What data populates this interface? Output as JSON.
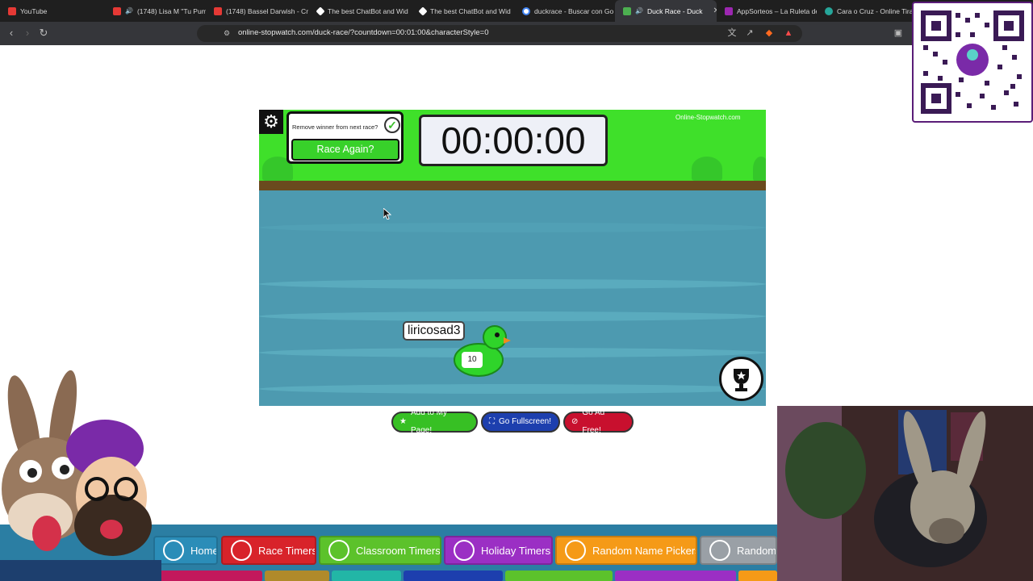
{
  "browser": {
    "tabs": [
      {
        "title": "YouTube",
        "favicon_color": "#e53935"
      },
      {
        "title": "(1748) Lisa M \"Tu Pum",
        "favicon_color": "#e53935"
      },
      {
        "title": "(1748) Bassel Darwish - Cr",
        "favicon_color": "#e53935"
      },
      {
        "title": "The best ChatBot and Wid",
        "favicon_color": "#ffffff"
      },
      {
        "title": "The best ChatBot and Wid",
        "favicon_color": "#ffffff"
      },
      {
        "title": "duckrace - Buscar con Go",
        "favicon_color": "#4285f4"
      },
      {
        "title": "Duck Race - Duck",
        "favicon_color": "#4caf50",
        "active": true
      },
      {
        "title": "AppSorteos – La Ruleta de",
        "favicon_color": "#9c27b0"
      },
      {
        "title": "Cara o Cruz - Online Tirar",
        "favicon_color": "#26a69a"
      }
    ],
    "url": "online-stopwatch.com/duck-race/?countdown=00:01:00&characterStyle=0"
  },
  "game": {
    "remove_winner_label": "Remove winner from next race?",
    "race_again_label": "Race Again?",
    "timer": "00:00:00",
    "brand": "Online-Stopwatch.com",
    "duck_name": "liricosad3",
    "duck_number": "10",
    "colors": {
      "grass": "#3fe02a",
      "water": "#4d9ab0",
      "duck": "#2fd42a"
    }
  },
  "actions": {
    "add_label": "Add to My Page!",
    "fullscreen_label": "Go Fullscreen!",
    "adfree_label": "Go Ad Free!"
  },
  "bottom_nav": {
    "items": [
      {
        "label": "Home",
        "color": "#2b8db8"
      },
      {
        "label": "Race Timers",
        "color": "#d8232a"
      },
      {
        "label": "Classroom Timers",
        "color": "#5cc22b"
      },
      {
        "label": "Holiday Timers",
        "color": "#9b2fc4"
      },
      {
        "label": "Random Name Pickers",
        "color": "#f59a17"
      },
      {
        "label": "Random N",
        "color": "#9aa0a6"
      }
    ]
  }
}
